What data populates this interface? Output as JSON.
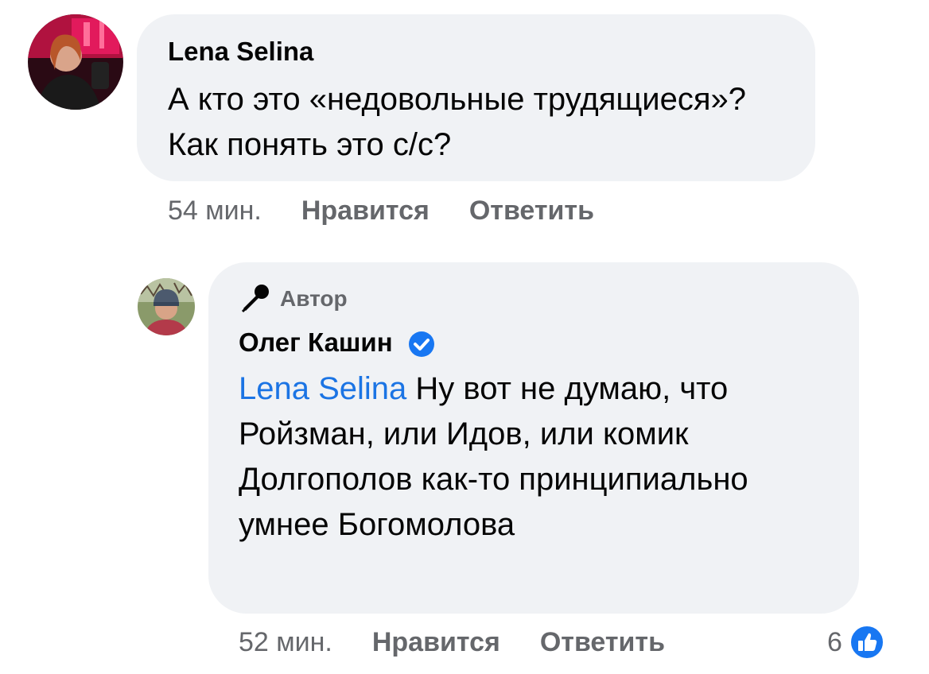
{
  "comment": {
    "author": "Lena Selina",
    "text": "А кто это «недовольные трудящиеся»? Как понять это с/с?",
    "time": "54 мин.",
    "like_label": "Нравится",
    "reply_label": "Ответить"
  },
  "reply": {
    "badge": "Автор",
    "author": "Олег Кашин",
    "mention": "Lena Selina",
    "text": "Ну вот не думаю, что Ройзман, или Идов, или комик Долгополов как-то принципиально умнее Богомолова",
    "time": "52 мин.",
    "like_label": "Нравится",
    "reply_label": "Ответить",
    "reaction_count": "6"
  },
  "colors": {
    "bubble": "#f0f2f5",
    "meta": "#65676b",
    "mention": "#1b74e4",
    "verified": "#1877f2"
  }
}
